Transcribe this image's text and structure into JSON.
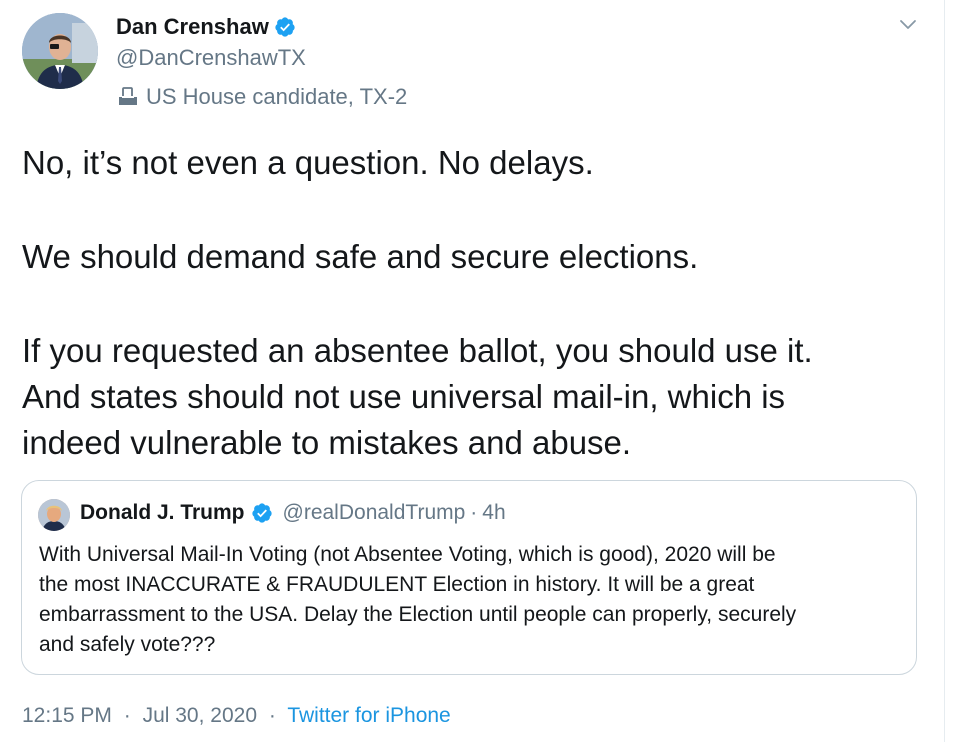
{
  "author": {
    "display_name": "Dan Crenshaw",
    "handle": "@DanCrenshawTX",
    "label": "US House candidate, TX-2"
  },
  "tweet": {
    "lines": [
      "No, it’s not even a question. No delays.",
      "We should demand safe and secure elections.",
      "If you requested an absentee ballot, you should use it.",
      "And states should not use universal mail-in, which is",
      "indeed vulnerable to mistakes and abuse."
    ]
  },
  "quoted": {
    "display_name": "Donald J. Trump",
    "handle": "@realDonaldTrump",
    "dot": "·",
    "time": "4h",
    "lines": [
      "With Universal Mail-In Voting (not Absentee Voting, which is good), 2020 will be",
      "the most INACCURATE & FRAUDULENT Election in history. It will be a great",
      "embarrassment to the USA. Delay the Election until people can properly, securely",
      "and safely vote???"
    ]
  },
  "meta": {
    "time": "12:15 PM",
    "separator": "·",
    "date": "Jul 30, 2020",
    "source": "Twitter for iPhone"
  },
  "icons": {
    "verified": "verified-badge-icon",
    "ballot": "ballot-box-icon",
    "caret": "chevron-down-icon"
  },
  "colors": {
    "verified": "#1da1f2",
    "link": "#1b95e0",
    "secondary_text": "#657786",
    "border": "#ccd6dd"
  }
}
